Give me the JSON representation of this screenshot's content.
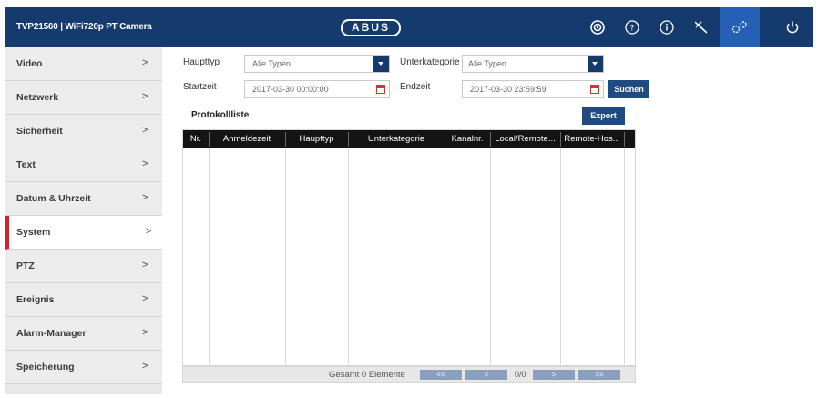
{
  "header": {
    "device_title": "TVP21560 | WiFi720p PT Camera",
    "logo": "ABUS",
    "icons": [
      "live-view-icon",
      "help-icon",
      "info-icon",
      "tools-icon",
      "settings-gears-icon",
      "power-icon"
    ],
    "active_icon": "settings-gears-icon",
    "color": "#143a6e",
    "active_color": "#2560b6"
  },
  "sidebar": {
    "items": [
      {
        "label": "Video",
        "chevron": ">"
      },
      {
        "label": "Netzwerk",
        "chevron": ">"
      },
      {
        "label": "Sicherheit",
        "chevron": ">"
      },
      {
        "label": "Text",
        "chevron": ">"
      },
      {
        "label": "Datum & Uhrzeit",
        "chevron": ">"
      },
      {
        "label": "System",
        "chevron": ">"
      },
      {
        "label": "PTZ",
        "chevron": ">"
      },
      {
        "label": "Ereignis",
        "chevron": ">"
      },
      {
        "label": "Alarm-Manager",
        "chevron": ">"
      },
      {
        "label": "Speicherung",
        "chevron": ">"
      }
    ],
    "active_item": "System",
    "active_color": "#d2232a"
  },
  "filters": {
    "haupttyp_label": "Haupttyp",
    "haupttyp_value": "Alle Typen",
    "unterkategorie_label": "Unterkategorie",
    "unterkategorie_value": "Alle Typen",
    "startzeit_label": "Startzeit",
    "startzeit_value": "2017-03-30 00:00:00",
    "endzeit_label": "Endzeit",
    "endzeit_value": "2017-03-30 23:59:59",
    "search_label": "Suchen"
  },
  "log": {
    "title": "Protokollliste",
    "export_label": "Export",
    "columns": [
      "Nr.",
      "Anmeldezeit",
      "Haupttyp",
      "Unterkategorie",
      "Kanalnr.",
      "Local/Remote...",
      "Remote-Hos..."
    ],
    "rows": []
  },
  "pagination": {
    "total_text": "Gesamt 0 Elemente",
    "first": "<<",
    "prev": "<",
    "page": "0/0",
    "next": ">",
    "last": ">>"
  }
}
